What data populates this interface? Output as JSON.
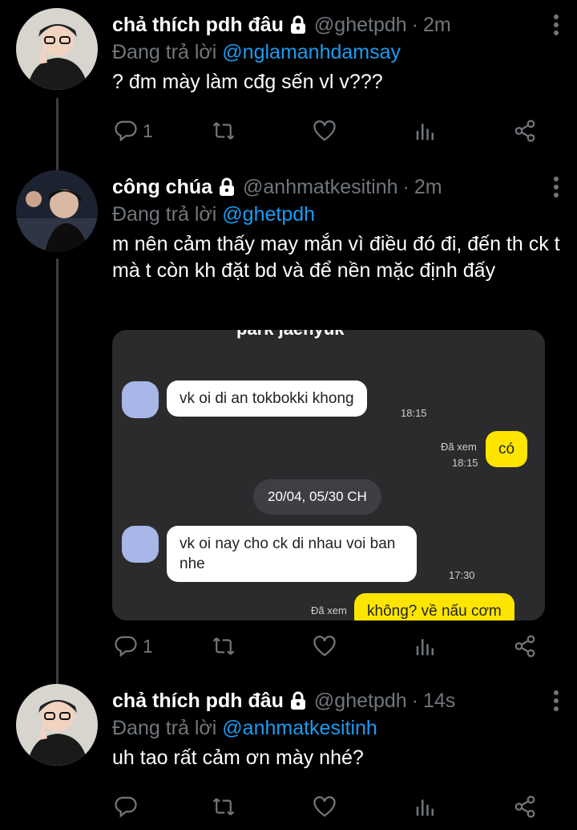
{
  "tweets": [
    {
      "name": "chả thích pdh đâu",
      "handle": "@ghetpdh",
      "time": "2m",
      "replying_prefix": "Đang trả lời",
      "replying_to": "@nglamanhdamsay",
      "text": "? đm mày làm cđg sến vl v???",
      "reply_count": "1"
    },
    {
      "name": "công chúa",
      "handle": "@anhmatkesitinh",
      "time": "2m",
      "replying_prefix": "Đang trả lời",
      "replying_to": "@ghetpdh",
      "text": "m nên cảm thấy may mắn vì điều đó đi, đến th ck t mà t còn kh đặt bd và để nền mặc định đấy",
      "reply_count": "1",
      "media": {
        "chat_title": "park jaehyuk",
        "messages": [
          {
            "text": "vk oi di an tokbokki khong",
            "time": "18:15"
          },
          {
            "text": "có",
            "seen": "Đã xem",
            "time": "18:15"
          },
          {
            "text": "20/04, 05/30 CH"
          },
          {
            "text": "vk oi nay cho ck di nhau voi ban nhe",
            "time": "17:30"
          },
          {
            "text": "không? về nấu cơm",
            "seen": "Đã xem"
          }
        ]
      }
    },
    {
      "name": "chả thích pdh đâu",
      "handle": "@ghetpdh",
      "time": "14s",
      "replying_prefix": "Đang trả lời",
      "replying_to": "@anhmatkesitinh",
      "text": "uh tao rất cảm ơn mày nhé?",
      "reply_count": ""
    }
  ],
  "colors": {
    "background": "#000000",
    "muted": "#71767b",
    "link": "#1d9bf0",
    "bubble_out": "#fee500"
  },
  "icons": [
    "lock-icon",
    "more-icon",
    "reply-icon",
    "retweet-icon",
    "like-icon",
    "views-icon",
    "share-icon"
  ]
}
